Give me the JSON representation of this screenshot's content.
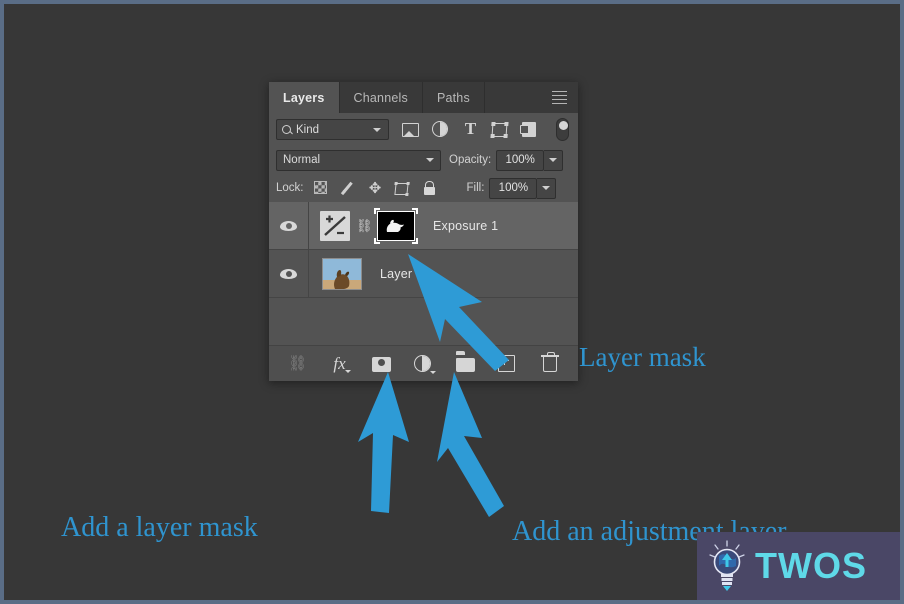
{
  "panel": {
    "tabs": [
      {
        "label": "Layers",
        "active": true
      },
      {
        "label": "Channels",
        "active": false
      },
      {
        "label": "Paths",
        "active": false
      }
    ],
    "menu_icon": "hamburger-menu-icon",
    "filter": {
      "kind_label": "Kind",
      "search_icon": "search-icon",
      "chevron_icon": "chevron-down-icon",
      "filter_icons": [
        "image-filter-icon",
        "adjustment-filter-icon",
        "type-filter-icon",
        "shape-filter-icon",
        "smart-object-filter-icon",
        "filter-toggle-switch"
      ]
    },
    "blend": {
      "mode": "Normal",
      "opacity_label": "Opacity:",
      "opacity_value": "100%"
    },
    "lock": {
      "label": "Lock:",
      "icons": [
        "lock-transparent-pixels-icon",
        "lock-image-pixels-icon",
        "lock-position-icon",
        "lock-artboard-nesting-icon",
        "lock-all-icon"
      ],
      "fill_label": "Fill:",
      "fill_value": "100%"
    },
    "layers": [
      {
        "name": "Exposure 1",
        "selected": true,
        "visibility_icon": "eye-icon",
        "thumbnail_icon": "exposure-adjustment-icon",
        "link_icon": "link-mask-icon",
        "mask_thumbnail": "layer-mask-thumbnail"
      },
      {
        "name": "Layer 0",
        "selected": false,
        "visibility_icon": "eye-icon",
        "thumbnail_icon": "layer-photo-thumbnail"
      }
    ],
    "toolbar": [
      {
        "name": "link-layers-button",
        "glyph": "link-icon"
      },
      {
        "name": "layer-style-button",
        "glyph": "fx-icon"
      },
      {
        "name": "add-layer-mask-button",
        "glyph": "layer-mask-icon"
      },
      {
        "name": "new-adjustment-layer-button",
        "glyph": "adjustment-circle-icon"
      },
      {
        "name": "new-group-button",
        "glyph": "folder-icon"
      },
      {
        "name": "new-layer-button",
        "glyph": "plus-square-icon"
      },
      {
        "name": "delete-layer-button",
        "glyph": "trash-icon"
      }
    ]
  },
  "annotations": {
    "layer_mask": "Layer mask",
    "add_layer_mask": "Add a layer mask",
    "add_adjustment_layer": "Add an adjustment layer",
    "arrow_color": "#2e9bd6"
  },
  "watermark": {
    "text": "TWOS",
    "logo_icon": "lightbulb-logo-icon",
    "background_color": "#4a4766",
    "text_color": "#5fd9e8"
  },
  "colors": {
    "canvas_background": "#373737",
    "outer_border": "#5a6d86",
    "panel_background": "#535353",
    "tab_inactive": "#393939",
    "selected_row": "#646464",
    "annotation_blue": "#2f94cf"
  }
}
